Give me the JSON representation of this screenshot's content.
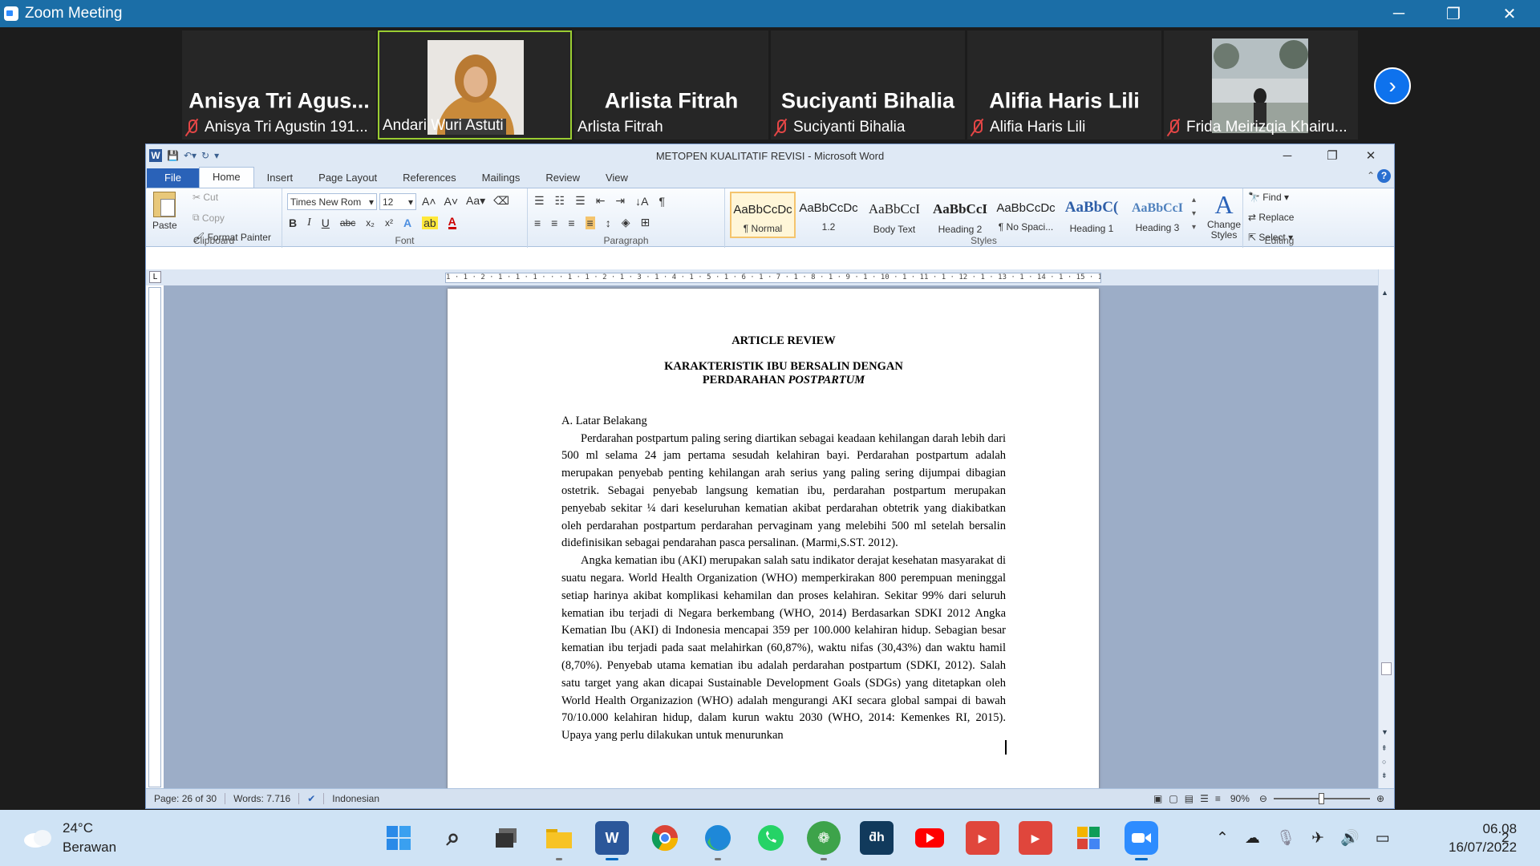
{
  "zoom": {
    "title": "Zoom Meeting",
    "participants": [
      {
        "big": "Anisya  Tri  Agus...",
        "label": "Anisya Tri Agustin 191..."
      },
      {
        "big": "",
        "label": "Andari Wuri Astuti"
      },
      {
        "big": "Arlista Fitrah",
        "label": "Arlista Fitrah"
      },
      {
        "big": "Suciyanti Bihalia",
        "label": "Suciyanti Bihalia"
      },
      {
        "big": "Alifia Haris Lili",
        "label": "Alifia Haris Lili"
      },
      {
        "big": "",
        "label": "Frida Meirizqia Khairu..."
      }
    ]
  },
  "word": {
    "title": "METOPEN KUALITATIF REVISI  -  Microsoft Word",
    "tabs": [
      "File",
      "Home",
      "Insert",
      "Page Layout",
      "References",
      "Mailings",
      "Review",
      "View"
    ],
    "clipboard": {
      "paste": "Paste",
      "cut": "Cut",
      "copy": "Copy",
      "format_painter": "Format Painter",
      "label": "Clipboard"
    },
    "font": {
      "name": "Times New Rom",
      "size": "12",
      "label": "Font"
    },
    "paragraph": {
      "label": "Paragraph"
    },
    "styles": {
      "label": "Styles",
      "items": [
        {
          "preview": "AaBbCcDc",
          "name": "¶ Normal"
        },
        {
          "preview": "AaBbCcDc",
          "name": "1.2"
        },
        {
          "preview": "AaBbCcI",
          "name": "Body Text"
        },
        {
          "preview": "AaBbCcI",
          "name": "Heading 2"
        },
        {
          "preview": "AaBbCcDc",
          "name": "¶ No Spaci..."
        },
        {
          "preview": "AaBbC(",
          "name": "Heading 1"
        },
        {
          "preview": "AaBbCcI",
          "name": "Heading 3"
        }
      ],
      "change": "Change Styles"
    },
    "editing": {
      "find": "Find",
      "replace": "Replace",
      "select": "Select",
      "label": "Editing"
    },
    "ruler_text": "1 · 1 · 2 · 1 · 1 · 1 ·  ·  · 1 · 1 · 2 · 1 · 3 · 1 · 4 · 1 · 5 · 1 · 6 · 1 · 7 · 1 · 8 · 1 · 9 · 1 · 10 · 1 · 11 · 1 · 12 · 1 · 13 · 1 · 14 · 1 · 15 · 1 · 16 · 1 · 17 · 1",
    "document": {
      "heading": "ARTICLE REVIEW",
      "title1": "KARAKTERISTIK  IBU BERSALIN  DENGAN",
      "title2a": "PERDARAHAN ",
      "title2b": "POSTPARTUM",
      "section": "A.  Latar Belakang",
      "para1": "Perdarahan postpartum paling sering diartikan sebagai keadaan kehilangan darah lebih dari 500 ml selama 24 jam pertama sesudah kelahiran bayi. Perdarahan postpartum adalah merupakan penyebab penting kehilangan arah serius yang paling sering dijumpai dibagian ostetrik. Sebagai penyebab langsung kematian ibu, perdarahan postpartum merupakan penyebab sekitar ¼ dari keseluruhan kematian akibat perdarahan obtetrik yang diakibatkan oleh perdarahan postpartum perdarahan pervaginam yang melebihi 500 ml setelah bersalin didefinisikan sebagai pendarahan pasca persalinan.  (Marmi,S.ST. 2012).",
      "para2": "Angka kematian ibu (AKI) merupakan salah satu indikator derajat kesehatan masyarakat di suatu negara. World Health Organization (WHO) memperkirakan 800 perempuan meninggal setiap harinya akibat komplikasi kehamilan dan proses kelahiran. Sekitar 99% dari seluruh kematian ibu terjadi di Negara berkembang (WHO, 2014) Berdasarkan SDKI 2012 Angka Kematian Ibu (AKI) di Indonesia mencapai 359 per 100.000 kelahiran hidup. Sebagian besar kematian ibu terjadi pada saat melahirkan (60,87%), waktu nifas (30,43%) dan waktu hamil (8,70%). Penyebab utama kematian ibu adalah perdarahan postpartum (SDKI, 2012). Salah satu target yang akan dicapai Sustainable Development Goals (SDGs) yang ditetapkan oleh World Health Organizazion (WHO) adalah mengurangi AKI secara global sampai di bawah 70/10.000 kelahiran hidup, dalam kurun waktu 2030 (WHO, 2014: Kemenkes RI, 2015). Upaya yang perlu dilakukan untuk menurunkan"
    },
    "status": {
      "page": "Page: 26 of 30",
      "words": "Words: 7.716",
      "lang": "Indonesian",
      "zoom": "90%"
    }
  },
  "taskbar": {
    "weather_temp": "24°C",
    "weather_desc": "Berawan",
    "time": "06.08",
    "date": "16/07/2022",
    "notif": "2",
    "apps": [
      "windows-start",
      "search",
      "task-view",
      "file-explorer",
      "word",
      "chrome",
      "edge",
      "whatsapp",
      "app-green",
      "app-dh",
      "youtube",
      "app-red-1",
      "app-red-2",
      "app-puzzle",
      "zoom"
    ]
  }
}
